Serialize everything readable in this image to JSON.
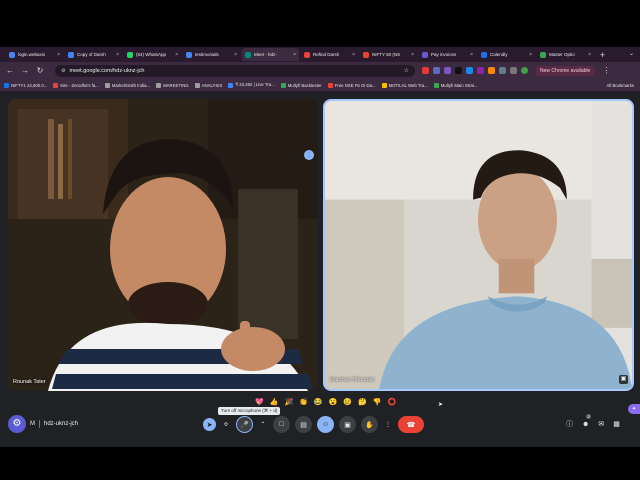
{
  "tabs": [
    {
      "label": "login.webaxis",
      "color": "#4285f4",
      "active": false
    },
    {
      "label": "Copy of Darsh",
      "color": "#4285f4",
      "active": false
    },
    {
      "label": "(84) WhatsApp",
      "color": "#25d366",
      "active": false
    },
    {
      "label": "testimonials",
      "color": "#4285f4",
      "active": false
    },
    {
      "label": "Meet - hdz-",
      "color": "#00897b",
      "active": true
    },
    {
      "label": "Refind Darsh",
      "color": "#ea4335",
      "active": false
    },
    {
      "label": "NIFTY 50 (NS",
      "color": "#ea4335",
      "active": false
    },
    {
      "label": "Pay invoices",
      "color": "#6a5acd",
      "active": false
    },
    {
      "label": "Calendly",
      "color": "#1a73e8",
      "active": false
    },
    {
      "label": "Master Optio",
      "color": "#34a853",
      "active": false
    }
  ],
  "toolbar": {
    "url": "meet.google.com/hdz-uknz-jch",
    "new_chrome": "New Chrome available"
  },
  "bookmarks": [
    {
      "label": "NIFTY1 24,600.0...",
      "color": "#1a73e8"
    },
    {
      "label": "Kite - Zerodha's fa...",
      "color": "#ea4335"
    },
    {
      "label": "MarketSmith India...",
      "color": "#9e9e9e"
    },
    {
      "label": "MARKETING",
      "color": "#9e9e9e"
    },
    {
      "label": "ANALYSIS",
      "color": "#9e9e9e"
    },
    {
      "label": "₹ 23,462 | Live Tra...",
      "color": "#4285f4"
    },
    {
      "label": "Multyfi Backtester",
      "color": "#34a853"
    },
    {
      "label": "Free NSE F6 Oi Da...",
      "color": "#ea4335"
    },
    {
      "label": "MOTILAL Web Tra...",
      "color": "#fbbc04"
    },
    {
      "label": "Multyfi Main Strat...",
      "color": "#34a853"
    }
  ],
  "all_bookmarks": "All Bookmarks",
  "participants": [
    {
      "name": "Rounak Tater"
    },
    {
      "name": "Darshan Bhandari"
    }
  ],
  "meeting": {
    "code": "hdz-uknz-jch",
    "time_suffix": "M",
    "tooltip": "Turn off microphone (⌘ + d)",
    "people_count": "2"
  },
  "reactions": [
    "💖",
    "👍",
    "🎉",
    "👏",
    "😂",
    "😮",
    "😢",
    "🤔",
    "👎",
    "⭕"
  ]
}
